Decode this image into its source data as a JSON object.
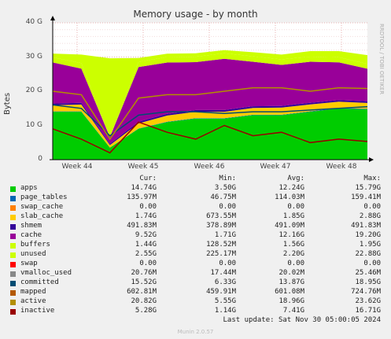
{
  "title": "Memory usage - by month",
  "side_text": "RRDTOOL / TOBI OETIKER",
  "ylabel": "Bytes",
  "yticks": [
    "0",
    "10 G",
    "20 G",
    "30 G",
    "40 G"
  ],
  "xticks": [
    "Week 44",
    "Week 45",
    "Week 46",
    "Week 47",
    "Week 48"
  ],
  "legend_headers": {
    "cur": "Cur:",
    "min": "Min:",
    "avg": "Avg:",
    "max": "Max:"
  },
  "legend": [
    {
      "name": "apps",
      "color": "#00cc00",
      "cur": "14.74G",
      "min": "3.50G",
      "avg": "12.24G",
      "max": "15.79G"
    },
    {
      "name": "page_tables",
      "color": "#0066b3",
      "cur": "135.97M",
      "min": "46.75M",
      "avg": "114.03M",
      "max": "159.41M"
    },
    {
      "name": "swap_cache",
      "color": "#ff8000",
      "cur": "0.00",
      "min": "0.00",
      "avg": "0.00",
      "max": "0.00"
    },
    {
      "name": "slab_cache",
      "color": "#ffcc00",
      "cur": "1.74G",
      "min": "673.55M",
      "avg": "1.85G",
      "max": "2.88G"
    },
    {
      "name": "shmem",
      "color": "#330099",
      "cur": "491.83M",
      "min": "378.89M",
      "avg": "491.09M",
      "max": "491.83M"
    },
    {
      "name": "cache",
      "color": "#990099",
      "cur": "9.52G",
      "min": "1.71G",
      "avg": "12.16G",
      "max": "19.20G"
    },
    {
      "name": "buffers",
      "color": "#ccff00",
      "cur": "1.44G",
      "min": "128.52M",
      "avg": "1.56G",
      "max": "1.95G"
    },
    {
      "name": "unused",
      "color": "#ccff00",
      "cur": "2.55G",
      "min": "225.17M",
      "avg": "2.20G",
      "max": "22.88G"
    },
    {
      "name": "swap",
      "color": "#ff0000",
      "cur": "0.00",
      "min": "0.00",
      "avg": "0.00",
      "max": "0.00"
    },
    {
      "name": "vmalloc_used",
      "color": "#888888",
      "cur": "20.76M",
      "min": "17.44M",
      "avg": "20.02M",
      "max": "25.46M"
    },
    {
      "name": "committed",
      "color": "#004d73",
      "cur": "15.52G",
      "min": "6.33G",
      "avg": "13.87G",
      "max": "18.95G"
    },
    {
      "name": "mapped",
      "color": "#b35900",
      "cur": "602.81M",
      "min": "459.91M",
      "avg": "601.08M",
      "max": "724.76M"
    },
    {
      "name": "active",
      "color": "#b38f00",
      "cur": "20.82G",
      "min": "5.55G",
      "avg": "18.96G",
      "max": "23.62G"
    },
    {
      "name": "inactive",
      "color": "#990000",
      "cur": "5.28G",
      "min": "1.14G",
      "avg": "7.41G",
      "max": "16.71G"
    }
  ],
  "last_update": "Last update: Sat Nov 30 05:00:05 2024",
  "munin_version": "Munin 2.0.57",
  "chart_data": {
    "type": "area",
    "title": "Memory usage - by month",
    "ylabel": "Bytes",
    "unit": "G",
    "ylim": [
      0,
      40
    ],
    "grid": true,
    "categories": [
      "Week 44",
      "Week 45",
      "Week 46",
      "Week 47",
      "Week 48"
    ],
    "stacked_series": [
      {
        "name": "apps",
        "color": "#00cc00",
        "values": [
          14,
          14,
          3.5,
          9,
          11,
          12,
          12,
          13,
          13,
          14,
          15,
          14.7
        ]
      },
      {
        "name": "page_tables",
        "color": "#0066b3",
        "values": [
          0.12,
          0.12,
          0.05,
          0.1,
          0.1,
          0.11,
          0.11,
          0.12,
          0.12,
          0.13,
          0.14,
          0.14
        ]
      },
      {
        "name": "slab_cache",
        "color": "#ffcc00",
        "values": [
          1.8,
          2.0,
          0.7,
          1.5,
          1.8,
          1.9,
          1.9,
          2.0,
          2.1,
          2.0,
          1.8,
          1.74
        ]
      },
      {
        "name": "shmem",
        "color": "#330099",
        "values": [
          0.49,
          0.49,
          0.38,
          0.49,
          0.49,
          0.49,
          0.49,
          0.49,
          0.49,
          0.49,
          0.49,
          0.49
        ]
      },
      {
        "name": "cache",
        "color": "#990099",
        "values": [
          12,
          10,
          2,
          16,
          15,
          14,
          15,
          13,
          12,
          12,
          11,
          9.5
        ]
      },
      {
        "name": "buffers",
        "color": "#ccff00",
        "values": [
          1.5,
          1.6,
          0.13,
          1.5,
          1.6,
          1.6,
          1.6,
          1.6,
          1.6,
          1.5,
          1.5,
          1.44
        ]
      },
      {
        "name": "unused",
        "color": "#ccff00",
        "values": [
          1.1,
          2.5,
          22.88,
          1.1,
          1.0,
          1.0,
          0.9,
          1.2,
          1.4,
          1.6,
          1.8,
          2.55
        ]
      }
    ],
    "line_series": [
      {
        "name": "committed",
        "color": "#004d73",
        "values": [
          16,
          15,
          7,
          13,
          14,
          14,
          13.5,
          14,
          14,
          14.5,
          15,
          15.5
        ]
      },
      {
        "name": "active",
        "color": "#b38f00",
        "values": [
          20,
          19,
          6,
          18,
          19,
          19,
          20,
          21,
          21,
          20,
          21,
          20.8
        ]
      },
      {
        "name": "inactive",
        "color": "#990000",
        "values": [
          9,
          6,
          2,
          11,
          8,
          6,
          10,
          7,
          8,
          5,
          6,
          5.3
        ]
      }
    ]
  }
}
